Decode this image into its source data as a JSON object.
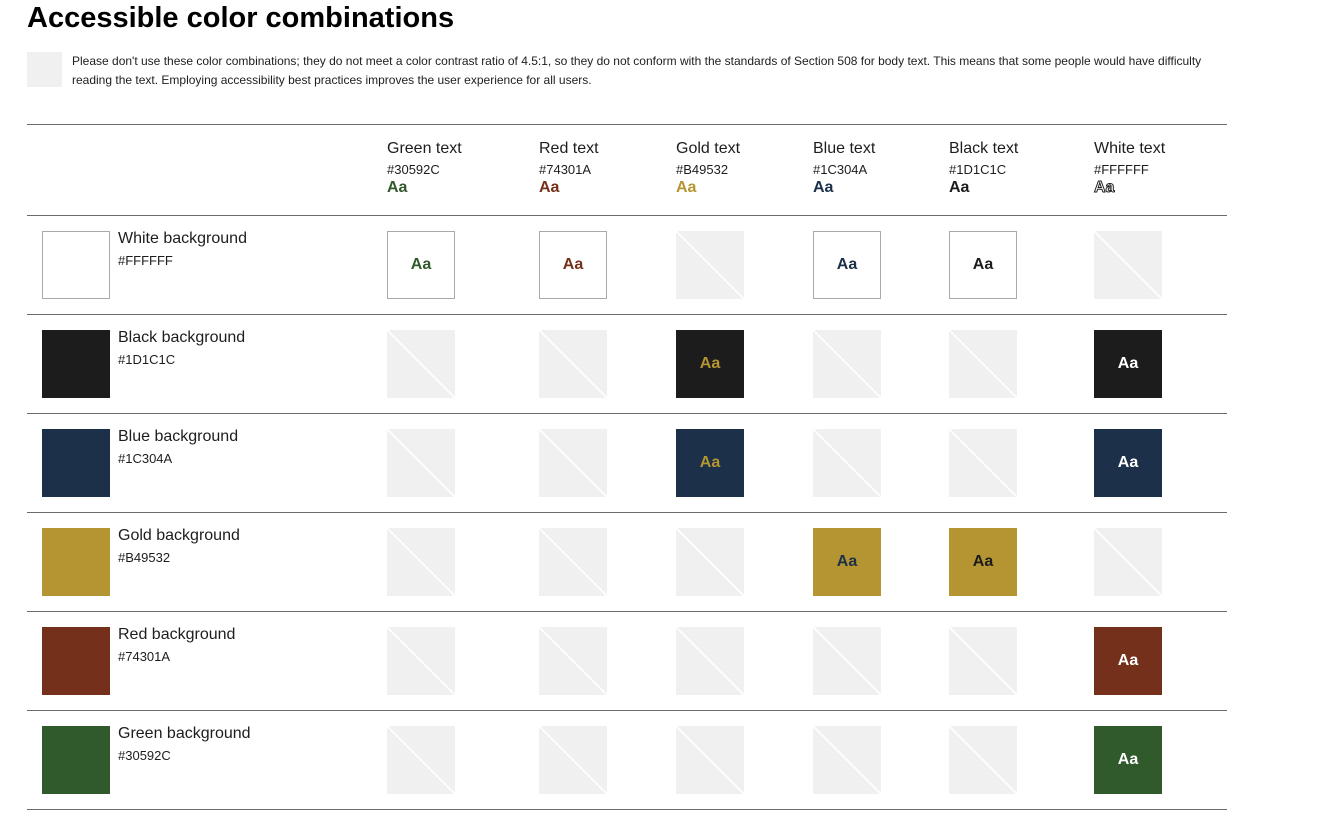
{
  "title": "Accessible color combinations",
  "note": {
    "icon": "not-accessible-swatch-icon",
    "text": "Please don't use these color combinations; they do not meet a color contrast ratio of 4.5:1, so they do not conform with the standards of Section 508 for body text. This means that some people would have difficulty reading the text. Employing accessibility best practices improves the user experience for all users."
  },
  "sample_text": "Aa",
  "text_colors": [
    {
      "name": "Green text",
      "hex": "#30592C"
    },
    {
      "name": "Red text",
      "hex": "#74301A"
    },
    {
      "name": "Gold text",
      "hex": "#B49532"
    },
    {
      "name": "Blue text",
      "hex": "#1C304A"
    },
    {
      "name": "Black text",
      "hex": "#1D1C1C"
    },
    {
      "name": "White text",
      "hex": "#FFFFFF"
    }
  ],
  "backgrounds": [
    {
      "name": "White background",
      "hex": "#FFFFFF",
      "accessible": [
        true,
        true,
        false,
        true,
        true,
        false
      ]
    },
    {
      "name": "Black background",
      "hex": "#1D1C1C",
      "accessible": [
        false,
        false,
        true,
        false,
        false,
        true
      ]
    },
    {
      "name": "Blue background",
      "hex": "#1C304A",
      "accessible": [
        false,
        false,
        true,
        false,
        false,
        true
      ]
    },
    {
      "name": "Gold background",
      "hex": "#B49532",
      "accessible": [
        false,
        false,
        false,
        true,
        true,
        false
      ]
    },
    {
      "name": "Red background",
      "hex": "#74301A",
      "accessible": [
        false,
        false,
        false,
        false,
        false,
        true
      ]
    },
    {
      "name": "Green background",
      "hex": "#30592C",
      "accessible": [
        false,
        false,
        false,
        false,
        false,
        true
      ]
    }
  ]
}
